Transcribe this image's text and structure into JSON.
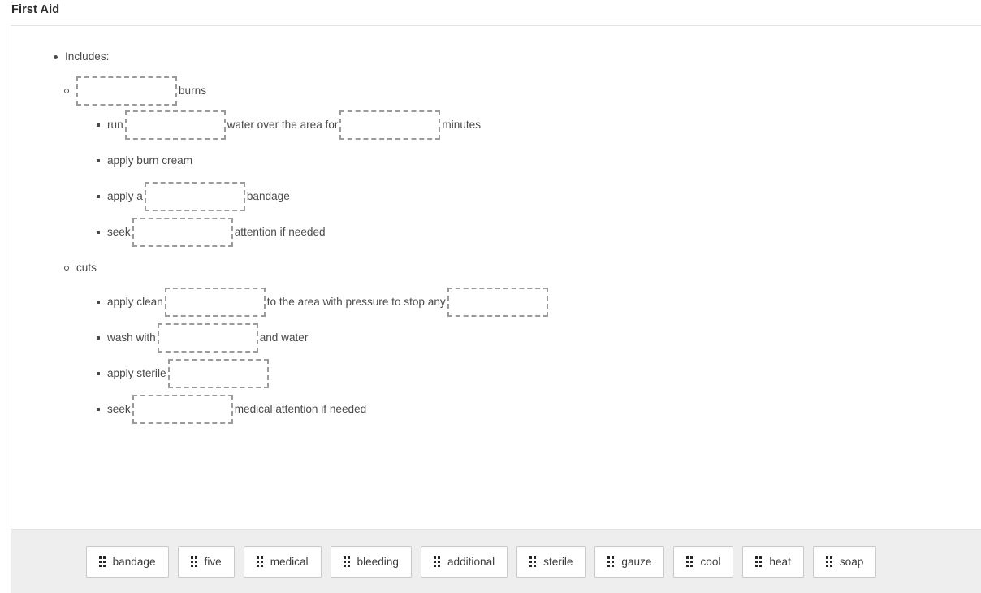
{
  "header": {
    "title": "First Aid"
  },
  "exercise": {
    "root_label": "Includes:",
    "sections": [
      {
        "label": "burns",
        "label_position": "after-blank",
        "steps": [
          {
            "parts": [
              {
                "type": "text",
                "value": "run"
              },
              {
                "type": "blank"
              },
              {
                "type": "text",
                "value": "water over the area for"
              },
              {
                "type": "blank"
              },
              {
                "type": "text",
                "value": "minutes"
              }
            ]
          },
          {
            "parts": [
              {
                "type": "text",
                "value": "apply burn cream"
              }
            ]
          },
          {
            "parts": [
              {
                "type": "text",
                "value": "apply a"
              },
              {
                "type": "blank"
              },
              {
                "type": "text",
                "value": "bandage"
              }
            ]
          },
          {
            "parts": [
              {
                "type": "text",
                "value": "seek"
              },
              {
                "type": "blank"
              },
              {
                "type": "text",
                "value": "attention if needed"
              }
            ]
          }
        ]
      },
      {
        "label": "cuts",
        "label_position": "plain",
        "steps": [
          {
            "parts": [
              {
                "type": "text",
                "value": "apply clean"
              },
              {
                "type": "blank"
              },
              {
                "type": "text",
                "value": "to the area with pressure to stop any"
              },
              {
                "type": "blank"
              }
            ]
          },
          {
            "parts": [
              {
                "type": "text",
                "value": "wash with"
              },
              {
                "type": "blank"
              },
              {
                "type": "text",
                "value": "and water"
              }
            ]
          },
          {
            "parts": [
              {
                "type": "text",
                "value": "apply sterile"
              },
              {
                "type": "blank"
              }
            ]
          },
          {
            "parts": [
              {
                "type": "text",
                "value": "seek"
              },
              {
                "type": "blank"
              },
              {
                "type": "text",
                "value": "medical attention if needed"
              }
            ]
          }
        ]
      }
    ]
  },
  "tray": {
    "chips": [
      {
        "label": "bandage",
        "icon": "drag-handle-icon"
      },
      {
        "label": "five",
        "icon": "drag-handle-icon"
      },
      {
        "label": "medical",
        "icon": "drag-handle-icon"
      },
      {
        "label": "bleeding",
        "icon": "drag-handle-icon"
      },
      {
        "label": "additional",
        "icon": "drag-handle-icon"
      },
      {
        "label": "sterile",
        "icon": "drag-handle-icon"
      },
      {
        "label": "gauze",
        "icon": "drag-handle-icon"
      },
      {
        "label": "cool",
        "icon": "drag-handle-icon"
      },
      {
        "label": "heat",
        "icon": "drag-handle-icon"
      },
      {
        "label": "soap",
        "icon": "drag-handle-icon"
      }
    ]
  },
  "colors": {
    "text": "#4a4a4a",
    "title": "#2b2b2b",
    "panel_border": "#e3e3e3",
    "dropzone_border": "#9b9b9b",
    "tray_background": "#eeeeee",
    "chip_border": "#c9c9c9"
  }
}
